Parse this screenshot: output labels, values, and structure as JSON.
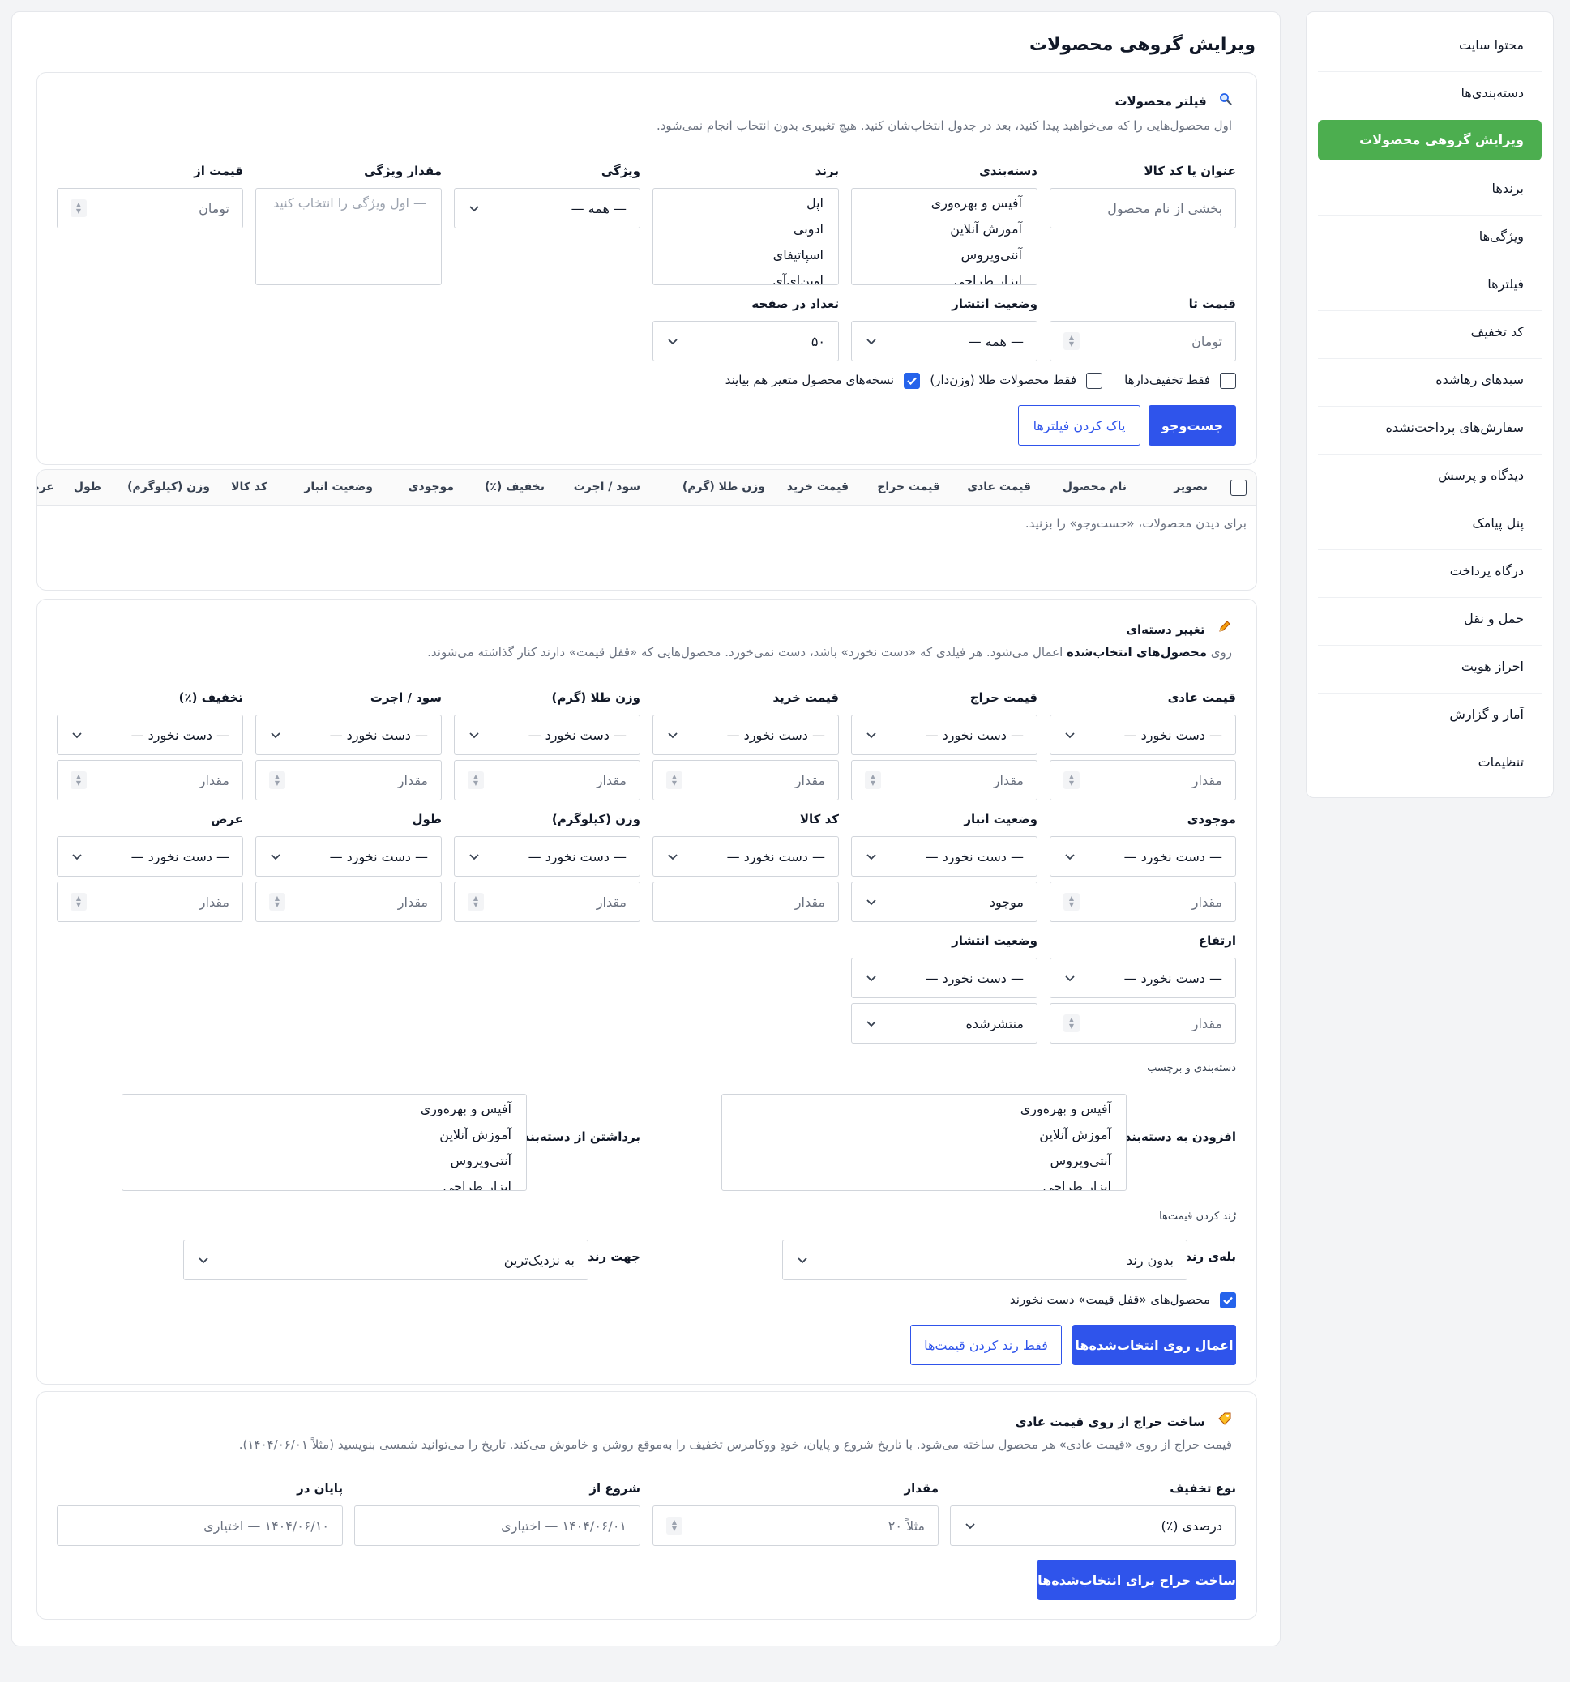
{
  "sidebar": {
    "items": [
      {
        "label": "محتوا سایت",
        "active": false
      },
      {
        "label": "دسته‌بندی‌ها",
        "active": false
      },
      {
        "label": "ویرایش گروهی محصولات",
        "active": true
      },
      {
        "label": "برندها",
        "active": false
      },
      {
        "label": "ویژگی‌ها",
        "active": false
      },
      {
        "label": "فیلترها",
        "active": false
      },
      {
        "label": "کد تخفیف",
        "active": false
      },
      {
        "label": "سبدهای رهاشده",
        "active": false
      },
      {
        "label": "سفارش‌های پرداخت‌نشده",
        "active": false
      },
      {
        "label": "دیدگاه و پرسش",
        "active": false
      },
      {
        "label": "پنل پیامک",
        "active": false
      },
      {
        "label": "درگاه پرداخت",
        "active": false
      },
      {
        "label": "حمل و نقل",
        "active": false
      },
      {
        "label": "احراز هویت",
        "active": false
      },
      {
        "label": "آمار و گزارش",
        "active": false
      },
      {
        "label": "تنظیمات",
        "active": false
      }
    ]
  },
  "page": {
    "title": "ویرایش گروهی محصولات"
  },
  "filter": {
    "icon": "search-icon",
    "title": "فیلتر محصولات",
    "desc": "اول محصول‌هایی را که می‌خواهید پیدا کنید، بعد در جدول انتخاب‌شان کنید. هیچ تغییری بدون انتخاب انجام نمی‌شود.",
    "title_label": "عنوان یا کد کالا",
    "title_placeholder": "بخشی از نام محصول",
    "category_label": "دسته‌بندی",
    "categories": [
      "آفیس و بهره‌وری",
      "آموزش آنلاین",
      "آنتی‌ویروس",
      "ابزار طراحی"
    ],
    "brand_label": "برند",
    "brands": [
      "اپل",
      "ادوبی",
      "اسپاتیفای",
      "اوپن‌ای‌آی"
    ],
    "feature_label": "ویژگی",
    "feature_value": "— همه —",
    "feature_value_label": "مقدار ویژگی",
    "feature_value_placeholder": "— اول ویژگی را انتخاب کنید",
    "price_from_label": "قیمت از",
    "price_from_placeholder": "تومان",
    "price_to_label": "قیمت تا",
    "price_to_placeholder": "تومان",
    "publish_label": "وضعیت انتشار",
    "publish_value": "— همه —",
    "per_page_label": "تعداد در صفحه",
    "per_page_value": "۵۰",
    "only_discounted": "فقط تخفیف‌دارها",
    "only_discounted_checked": false,
    "only_gold": "فقط محصولات طلا (وزن‌دار)",
    "only_gold_checked": false,
    "variations": "نسخه‌های محصول متغیر هم بیایند",
    "variations_checked": true,
    "search_btn": "جست‌وجو",
    "clear_btn": "پاک کردن فیلترها"
  },
  "table": {
    "columns": [
      "تصویر",
      "نام محصول",
      "قیمت عادی",
      "قیمت حراج",
      "قیمت خرید",
      "وزن طلا (گرم)",
      "سود / اجرت",
      "تخفیف (٪)",
      "موجودی",
      "وضعیت انبار",
      "کد کالا",
      "وزن (کیلوگرم)",
      "طول",
      "عرض"
    ],
    "empty": "برای دیدن محصولات، «جست‌وجو» را بزنید."
  },
  "bulk": {
    "icon": "pencil-icon",
    "title": "تغییر دسته‌ای",
    "desc_pre": "روی ",
    "desc_bold": "محصول‌های انتخاب‌شده",
    "desc_post": " اعمال می‌شود. هر فیلدی که «دست نخورد» باشد، دست نمی‌خورد. محصول‌هایی که «قفل قیمت» دارند کنار گذاشته می‌شوند.",
    "untouched": "— دست نخورد —",
    "amount_placeholder": "مقدار",
    "fields": [
      "قیمت عادی",
      "قیمت حراج",
      "قیمت خرید",
      "وزن طلا (گرم)",
      "سود / اجرت",
      "تخفیف (٪)",
      "موجودی",
      "وضعیت انبار",
      "کد کالا",
      "وزن (کیلوگرم)",
      "طول",
      "عرض",
      "ارتفاع",
      "وضعیت انتشار"
    ],
    "stock_status_value": "موجود",
    "publish_status_value": "منتشرشده",
    "category_tag_label": "دسته‌بندی و برچسب",
    "add_category_label": "افزودن به دسته‌بندی",
    "remove_category_label": "برداشتن از دسته‌بندی",
    "categories": [
      "آفیس و بهره‌وری",
      "آموزش آنلاین",
      "آنتی‌ویروس",
      "ابزار طراحی"
    ],
    "rounding_label": "رُند کردن قیمت‌ها",
    "round_step_label": "پله‌ی رند",
    "round_step_value": "بدون رند",
    "round_dir_label": "جهت رند",
    "round_dir_value": "به نزدیک‌ترین",
    "skip_locked": "محصول‌های «قفل قیمت» دست نخورند",
    "skip_locked_checked": true,
    "apply_btn": "اعمال روی انتخاب‌شده‌ها",
    "round_only_btn": "فقط رند کردن قیمت‌ها"
  },
  "sale": {
    "icon": "tag-icon",
    "title": "ساخت حراج از روی قیمت عادی",
    "desc": "قیمت حراج از روی «قیمت عادی» هر محصول ساخته می‌شود. با تاریخ شروع و پایان، خودِ ووکامرس تخفیف را به‌موقع روشن و خاموش می‌کند. تاریخ را می‌توانید شمسی بنویسید (مثلاً ۱۴۰۴/۰۶/۰۱).",
    "type_label": "نوع تخفیف",
    "type_value": "درصدی (٪)",
    "amount_label": "مقدار",
    "amount_placeholder": "مثلاً ۲۰",
    "start_label": "شروع از",
    "start_placeholder": "۱۴۰۴/۰۶/۰۱ — اختیاری",
    "end_label": "پایان در",
    "end_placeholder": "۱۴۰۴/۰۶/۱۰ — اختیاری",
    "create_btn": "ساخت حراج برای انتخاب‌شده‌ها"
  }
}
